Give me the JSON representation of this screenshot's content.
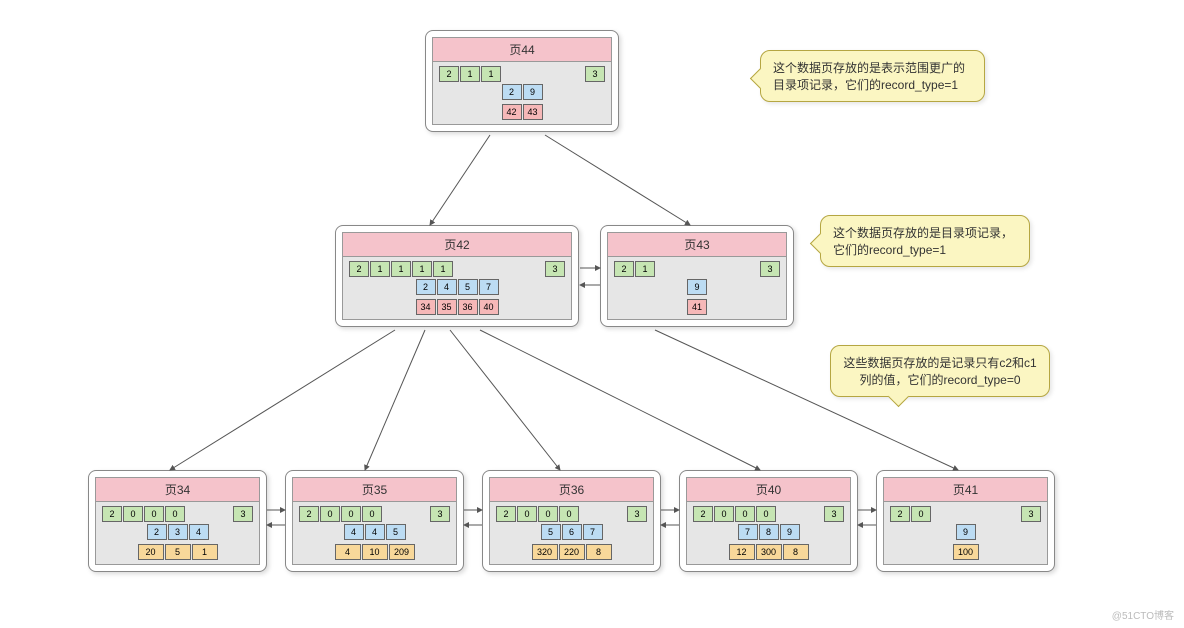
{
  "labels": {
    "pagePrefix": "页"
  },
  "watermark": "@51CTO博客",
  "annotations": {
    "top": "这个数据页存放的是表示范围更广的目录项记录，它们的record_type=1",
    "mid": "这个数据页存放的是目录项记录，它们的record_type=1",
    "bot": "这些数据页存放的是记录只有c2和c1列的值，它们的record_type=0"
  },
  "tree": {
    "root": {
      "pageNo": 44,
      "headers": [
        2,
        1,
        1,
        3
      ],
      "entries": [
        {
          "key": 2,
          "page": 42
        },
        {
          "key": 9,
          "page": 43
        }
      ]
    },
    "level1": [
      {
        "pageNo": 42,
        "headers": [
          2,
          1,
          1,
          1,
          1,
          3
        ],
        "entries": [
          {
            "key": 2,
            "page": 34
          },
          {
            "key": 4,
            "page": 35
          },
          {
            "key": 5,
            "page": 36
          },
          {
            "key": 7,
            "page": 40
          }
        ]
      },
      {
        "pageNo": 43,
        "headers": [
          2,
          1,
          3
        ],
        "entries": [
          {
            "key": 9,
            "page": 41
          }
        ]
      }
    ],
    "leaves": [
      {
        "pageNo": 34,
        "headers": [
          2,
          0,
          0,
          0,
          3
        ],
        "records": [
          {
            "c2": 2,
            "c1": 20
          },
          {
            "c2": 3,
            "c1": 5
          },
          {
            "c2": 4,
            "c1": 1
          }
        ]
      },
      {
        "pageNo": 35,
        "headers": [
          2,
          0,
          0,
          0,
          3
        ],
        "records": [
          {
            "c2": 4,
            "c1": 4
          },
          {
            "c2": 4,
            "c1": 10
          },
          {
            "c2": 5,
            "c1": 209
          }
        ]
      },
      {
        "pageNo": 36,
        "headers": [
          2,
          0,
          0,
          0,
          3
        ],
        "records": [
          {
            "c2": 5,
            "c1": 320
          },
          {
            "c2": 6,
            "c1": 220
          },
          {
            "c2": 7,
            "c1": 8
          }
        ]
      },
      {
        "pageNo": 40,
        "headers": [
          2,
          0,
          0,
          0,
          3
        ],
        "records": [
          {
            "c2": 7,
            "c1": 12
          },
          {
            "c2": 8,
            "c1": 300
          },
          {
            "c2": 9,
            "c1": 8
          }
        ]
      },
      {
        "pageNo": 41,
        "headers": [
          2,
          0,
          3
        ],
        "records": [
          {
            "c2": 9,
            "c1": 100
          }
        ]
      }
    ]
  },
  "chart_data": {
    "type": "table",
    "description": "B+ tree secondary-index structure, 3 levels",
    "levels": [
      {
        "level": 0,
        "pages": [
          {
            "no": 44,
            "record_type": 1,
            "children": [
              42,
              43
            ]
          }
        ]
      },
      {
        "level": 1,
        "pages": [
          {
            "no": 42,
            "record_type": 1,
            "children": [
              34,
              35,
              36,
              40
            ]
          },
          {
            "no": 43,
            "record_type": 1,
            "children": [
              41
            ]
          }
        ]
      },
      {
        "level": 2,
        "pages": [
          {
            "no": 34,
            "record_type": 0,
            "rows": [
              {
                "c2": 2,
                "c1": 20
              },
              {
                "c2": 3,
                "c1": 5
              },
              {
                "c2": 4,
                "c1": 1
              }
            ]
          },
          {
            "no": 35,
            "record_type": 0,
            "rows": [
              {
                "c2": 4,
                "c1": 4
              },
              {
                "c2": 4,
                "c1": 10
              },
              {
                "c2": 5,
                "c1": 209
              }
            ]
          },
          {
            "no": 36,
            "record_type": 0,
            "rows": [
              {
                "c2": 5,
                "c1": 320
              },
              {
                "c2": 6,
                "c1": 220
              },
              {
                "c2": 7,
                "c1": 8
              }
            ]
          },
          {
            "no": 40,
            "record_type": 0,
            "rows": [
              {
                "c2": 7,
                "c1": 12
              },
              {
                "c2": 8,
                "c1": 300
              },
              {
                "c2": 9,
                "c1": 8
              }
            ]
          },
          {
            "no": 41,
            "record_type": 0,
            "rows": [
              {
                "c2": 9,
                "c1": 100
              }
            ]
          }
        ]
      }
    ]
  }
}
